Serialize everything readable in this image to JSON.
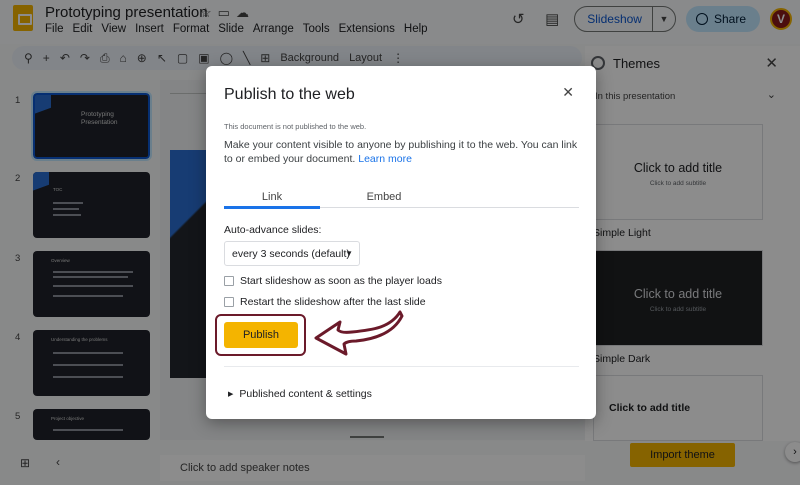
{
  "header": {
    "doc_title": "Prototyping presentation",
    "menu": [
      "File",
      "Edit",
      "View",
      "Insert",
      "Format",
      "Slide",
      "Arrange",
      "Tools",
      "Extensions",
      "Help"
    ],
    "slideshow_label": "Slideshow",
    "share_label": "Share",
    "avatar_letter": "V"
  },
  "toolbar": {
    "background_label": "Background",
    "layout_label": "Layout"
  },
  "filmstrip": {
    "slides": [
      {
        "number": "1",
        "title": "Prototyping Presentation"
      },
      {
        "number": "2",
        "title": "TOC"
      },
      {
        "number": "3",
        "title": "Overview"
      },
      {
        "number": "4",
        "title": "Understanding the problems"
      },
      {
        "number": "5",
        "title": "Project objective"
      }
    ]
  },
  "notes_placeholder": "Click to add speaker notes",
  "themes_panel": {
    "title": "Themes",
    "section_label": "In this presentation",
    "themes": [
      {
        "name": "Simple Light",
        "card_title": "Click to add title",
        "card_subtitle": "Click to add subtitle"
      },
      {
        "name": "Simple Dark",
        "card_title": "Click to add title",
        "card_subtitle": "Click to add subtitle"
      },
      {
        "name": "",
        "card_title": "Click to add title",
        "card_subtitle": ""
      }
    ],
    "import_label": "Import theme"
  },
  "dialog": {
    "title": "Publish to the web",
    "status": "This document is not published to the web.",
    "description": "Make your content visible to anyone by publishing it to the web. You can link to or embed your document.",
    "learn_more": "Learn more",
    "tabs": [
      "Link",
      "Embed"
    ],
    "auto_advance_label": "Auto-advance slides:",
    "auto_advance_value": "every 3 seconds (default)",
    "checkbox_start": "Start slideshow as soon as the player loads",
    "checkbox_restart": "Restart the slideshow after the last slide",
    "publish_label": "Publish",
    "published_settings": "Published content & settings"
  },
  "colors": {
    "accent_yellow": "#f4b400",
    "annotation_maroon": "#6b1a2a",
    "link_blue": "#1a73e8"
  }
}
